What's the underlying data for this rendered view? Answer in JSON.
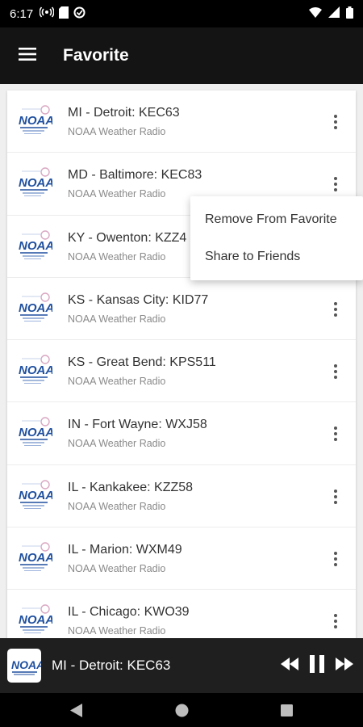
{
  "status": {
    "time": "6:17"
  },
  "app_bar": {
    "title": "Favorite"
  },
  "favorites": [
    {
      "title": "MI - Detroit: KEC63",
      "subtitle": "NOAA Weather Radio"
    },
    {
      "title": "MD - Baltimore: KEC83",
      "subtitle": "NOAA Weather Radio"
    },
    {
      "title": "KY - Owenton: KZZ4",
      "subtitle": "NOAA Weather Radio"
    },
    {
      "title": "KS - Kansas City: KID77",
      "subtitle": "NOAA Weather Radio"
    },
    {
      "title": "KS - Great Bend: KPS511",
      "subtitle": "NOAA Weather Radio"
    },
    {
      "title": "IN - Fort Wayne: WXJ58",
      "subtitle": "NOAA Weather Radio"
    },
    {
      "title": "IL - Kankakee: KZZ58",
      "subtitle": "NOAA Weather Radio"
    },
    {
      "title": "IL - Marion: WXM49",
      "subtitle": "NOAA Weather Radio"
    },
    {
      "title": "IL - Chicago: KWO39",
      "subtitle": "NOAA Weather Radio"
    }
  ],
  "logo_text": "NOAA",
  "popup_menu": {
    "remove": "Remove From Favorite",
    "share": "Share to Friends"
  },
  "player": {
    "now_playing": "MI - Detroit: KEC63"
  },
  "colors": {
    "app_bar": "#141414",
    "noaa_blue": "#1f4f9e",
    "player_bg": "#1f1f1f"
  }
}
